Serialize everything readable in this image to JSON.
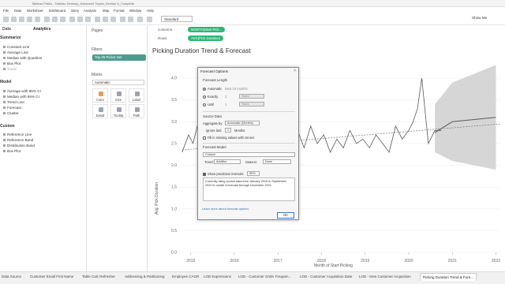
{
  "window": {
    "title": "Tableau Public - Tableau Desktop_Advanced Topics_Section 5_Complete"
  },
  "menu": [
    "File",
    "Data",
    "Worksheet",
    "Dashboard",
    "Story",
    "Analysis",
    "Map",
    "Format",
    "Window",
    "Help"
  ],
  "toolbar": {
    "view_size": "Standard",
    "show_me": "Show Me"
  },
  "left_pane": {
    "tab_data": "Data",
    "tab_analytics": "Analytics",
    "sections": [
      {
        "title": "Summarize",
        "items": [
          "Constant Line",
          "Average Line",
          "Median with Quartiles",
          "Box Plot",
          "Totals"
        ]
      },
      {
        "title": "Model",
        "items": [
          "Average with 95% CI",
          "Median with 95% CI",
          "Trend Line",
          "Forecast",
          "Cluster"
        ]
      },
      {
        "title": "Custom",
        "items": [
          "Reference Line",
          "Reference Band",
          "Distribution Band",
          "Box Plot"
        ]
      }
    ]
  },
  "cards": {
    "pages": "Pages",
    "filters": "Filters",
    "filter_pill": "Top 25 Picker Set",
    "marks": "Marks",
    "marks_type": "Automatic",
    "mark_buttons": [
      "Color",
      "Size",
      "Label",
      "Detail",
      "Tooltip",
      "Path"
    ]
  },
  "shelves": {
    "columns_label": "Columns",
    "columns_pill": "MONTH(Start Pick...",
    "rows_label": "Rows",
    "rows_pill": "AVG(Pick Duration)"
  },
  "chart": {
    "title": "Picking Duration Trend & Forecast",
    "ylabel": "Avg. Pick Duration",
    "xlabel": "Month of Start Picking",
    "yticks": [
      "4.0",
      "3.5",
      "3.0",
      "2.5",
      "2.0",
      "1.5",
      "1.0",
      "0.5",
      "0.0"
    ],
    "xticks": [
      "2015",
      "2016",
      "2017",
      "2018",
      "2019",
      "2020",
      "2021",
      "2022"
    ]
  },
  "chart_data": {
    "type": "line",
    "title": "Picking Duration Trend & Forecast",
    "xlabel": "Month of Start Picking",
    "ylabel": "Avg. Pick Duration",
    "ylim": [
      0,
      4.2
    ],
    "xlim": [
      2014.75,
      2022.1
    ],
    "series": [
      {
        "values_x": [
          2014.8,
          2014.95,
          2015.05,
          2015.15,
          2015.3,
          2015.45,
          2015.6,
          2015.75,
          2015.9,
          2016.05,
          2016.2,
          2016.35,
          2016.5,
          2016.65,
          2016.8,
          2016.95,
          2017.05,
          2017.15,
          2017.3,
          2017.45,
          2017.6,
          2017.75,
          2017.9,
          2018.05,
          2018.2,
          2018.35,
          2018.5,
          2018.65,
          2018.8,
          2018.95,
          2019.1,
          2019.25,
          2019.4,
          2019.55,
          2019.7,
          2019.85,
          2020.0,
          2020.1,
          2020.2,
          2020.3,
          2020.45,
          2020.6,
          2020.75
        ],
        "values_y": [
          2.3,
          2.7,
          2.5,
          2.9,
          2.6,
          2.2,
          2.8,
          2.5,
          2.4,
          2.6,
          2.5,
          2.8,
          2.2,
          2.4,
          2.6,
          2.7,
          2.5,
          2.3,
          2.6,
          2.8,
          2.4,
          2.9,
          2.5,
          2.7,
          2.3,
          2.6,
          2.4,
          2.8,
          2.5,
          2.6,
          2.4,
          2.7,
          2.5,
          2.3,
          2.9,
          2.6,
          2.8,
          3.0,
          3.3,
          4.0,
          2.5,
          2.8,
          2.8
        ]
      },
      {
        "values_x": [
          2020.6,
          2021.0,
          2022.0
        ],
        "values_y": [
          2.75,
          3.0,
          3.1
        ]
      }
    ],
    "trend_line": {
      "x": [
        2014.8,
        2022.1
      ],
      "y": [
        2.35,
        2.95
      ]
    },
    "forecast_band": {
      "x": [
        2020.6,
        2021.0,
        2022.0
      ],
      "upper": [
        3.4,
        3.9,
        4.3
      ],
      "lower": [
        2.3,
        2.1,
        1.9
      ]
    },
    "colors": {
      "line": "#595959",
      "trend": "#777777",
      "band": "#cccccc"
    }
  },
  "dialog": {
    "title": "Forecast Options",
    "close": "×",
    "forecast_length": "Forecast Length",
    "automatic": "Automatic",
    "automatic_note": "Next 15 months",
    "exactly": "Exactly",
    "until": "Until",
    "value1": "1",
    "value2": "1",
    "unit1": "Years",
    "unit2": "Years",
    "source_data": "Source Data",
    "aggregate_by": "Aggregate by:",
    "aggregate_value": "Automatic (Months)",
    "ignore_last": "Ignore last:",
    "ignore_value": "1",
    "ignore_unit": "Months",
    "fill_missing": "Fill in missing values with zeroes",
    "forecast_model": "Forecast Model",
    "model_value": "Custom",
    "trend_label": "Trend:",
    "trend_value": "Additive",
    "season_label": "Season:",
    "season_value": "None",
    "show_intervals": "Show prediction intervals",
    "interval_value": "95%",
    "summary": "Currently using source data from January 2015 to September 2020 to create a forecast through December 2021.",
    "learn_more": "Learn more about forecast options",
    "ok": "OK"
  },
  "tabs": [
    "Data Source",
    "Customer Email First Name",
    "Table Calc Refresher",
    "Addressing & Partitioning",
    "Employee CAGR",
    "LOD Expressions",
    "LOD - Customer Order Frequen...",
    "LOD - Customer Acquisition Date",
    "LOD - New Customer Acquisition",
    "Picking Duration Trend & Fore..."
  ]
}
